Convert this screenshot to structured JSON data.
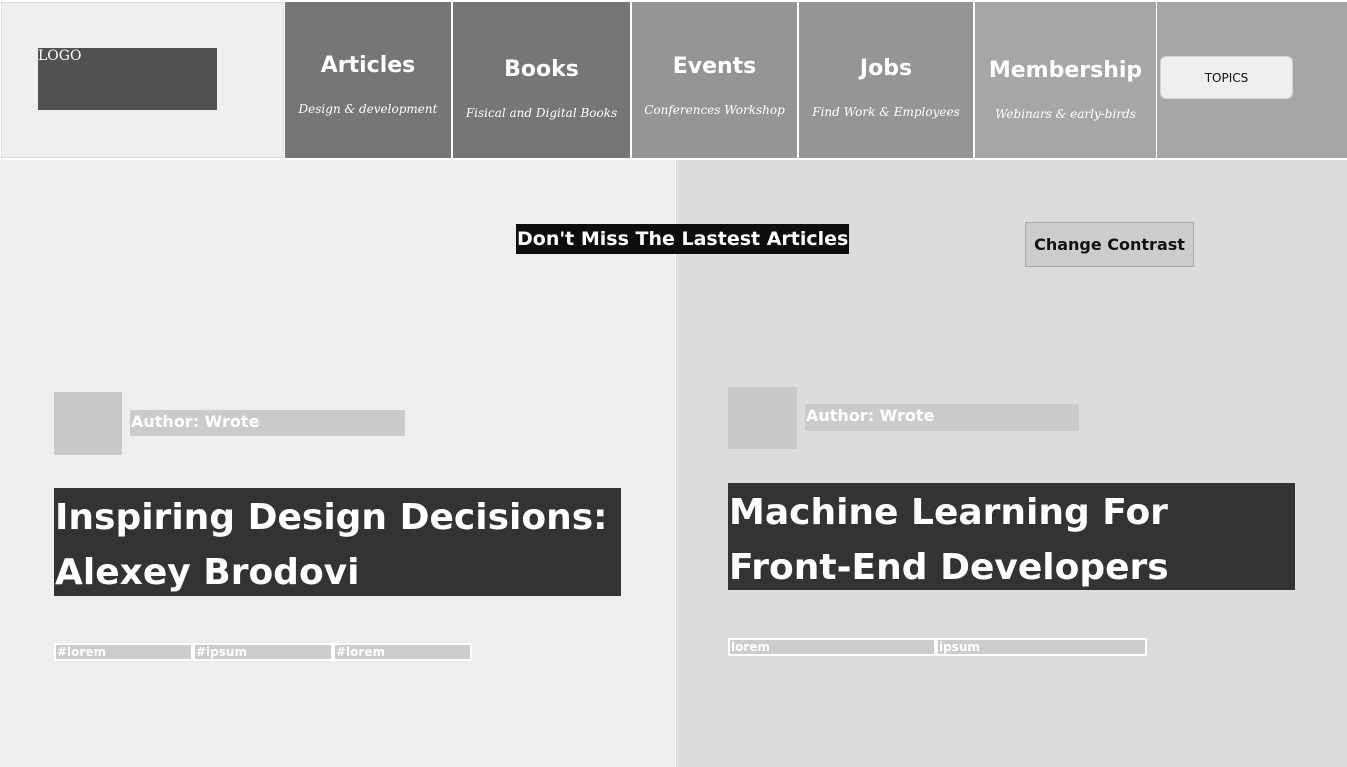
{
  "header": {
    "logo_label": "LOGO",
    "nav": [
      {
        "title": "Articles",
        "subtitle": "Design & development"
      },
      {
        "title": "Books",
        "subtitle": "Fisical and Digital Books"
      },
      {
        "title": "Events",
        "subtitle": "Conferences Workshop"
      },
      {
        "title": "Jobs",
        "subtitle": "Find Work & Employees"
      },
      {
        "title": "Membership",
        "subtitle": "Webinars & early-birds"
      }
    ],
    "topics_label": "TOPICS"
  },
  "banner": {
    "text": "Don't Miss The Lastest Articles"
  },
  "contrast_button_label": "Change Contrast",
  "articles": [
    {
      "author": "Author: Wrote",
      "title": "Inspiring Design Decisions: Alexey Brodovi",
      "tags": [
        "#lorem",
        "#ipsum",
        "#lorem"
      ]
    },
    {
      "author": "Author: Wrote",
      "title": "Machine Learning For Front-End Developers",
      "tags": [
        "lorem",
        "ipsum"
      ]
    }
  ],
  "colors": {
    "logo_box": "#515151",
    "nav_dark": "#767676",
    "nav_light": "#959595",
    "title_bg": "#333333",
    "banner_bg": "#0d0d0d"
  }
}
